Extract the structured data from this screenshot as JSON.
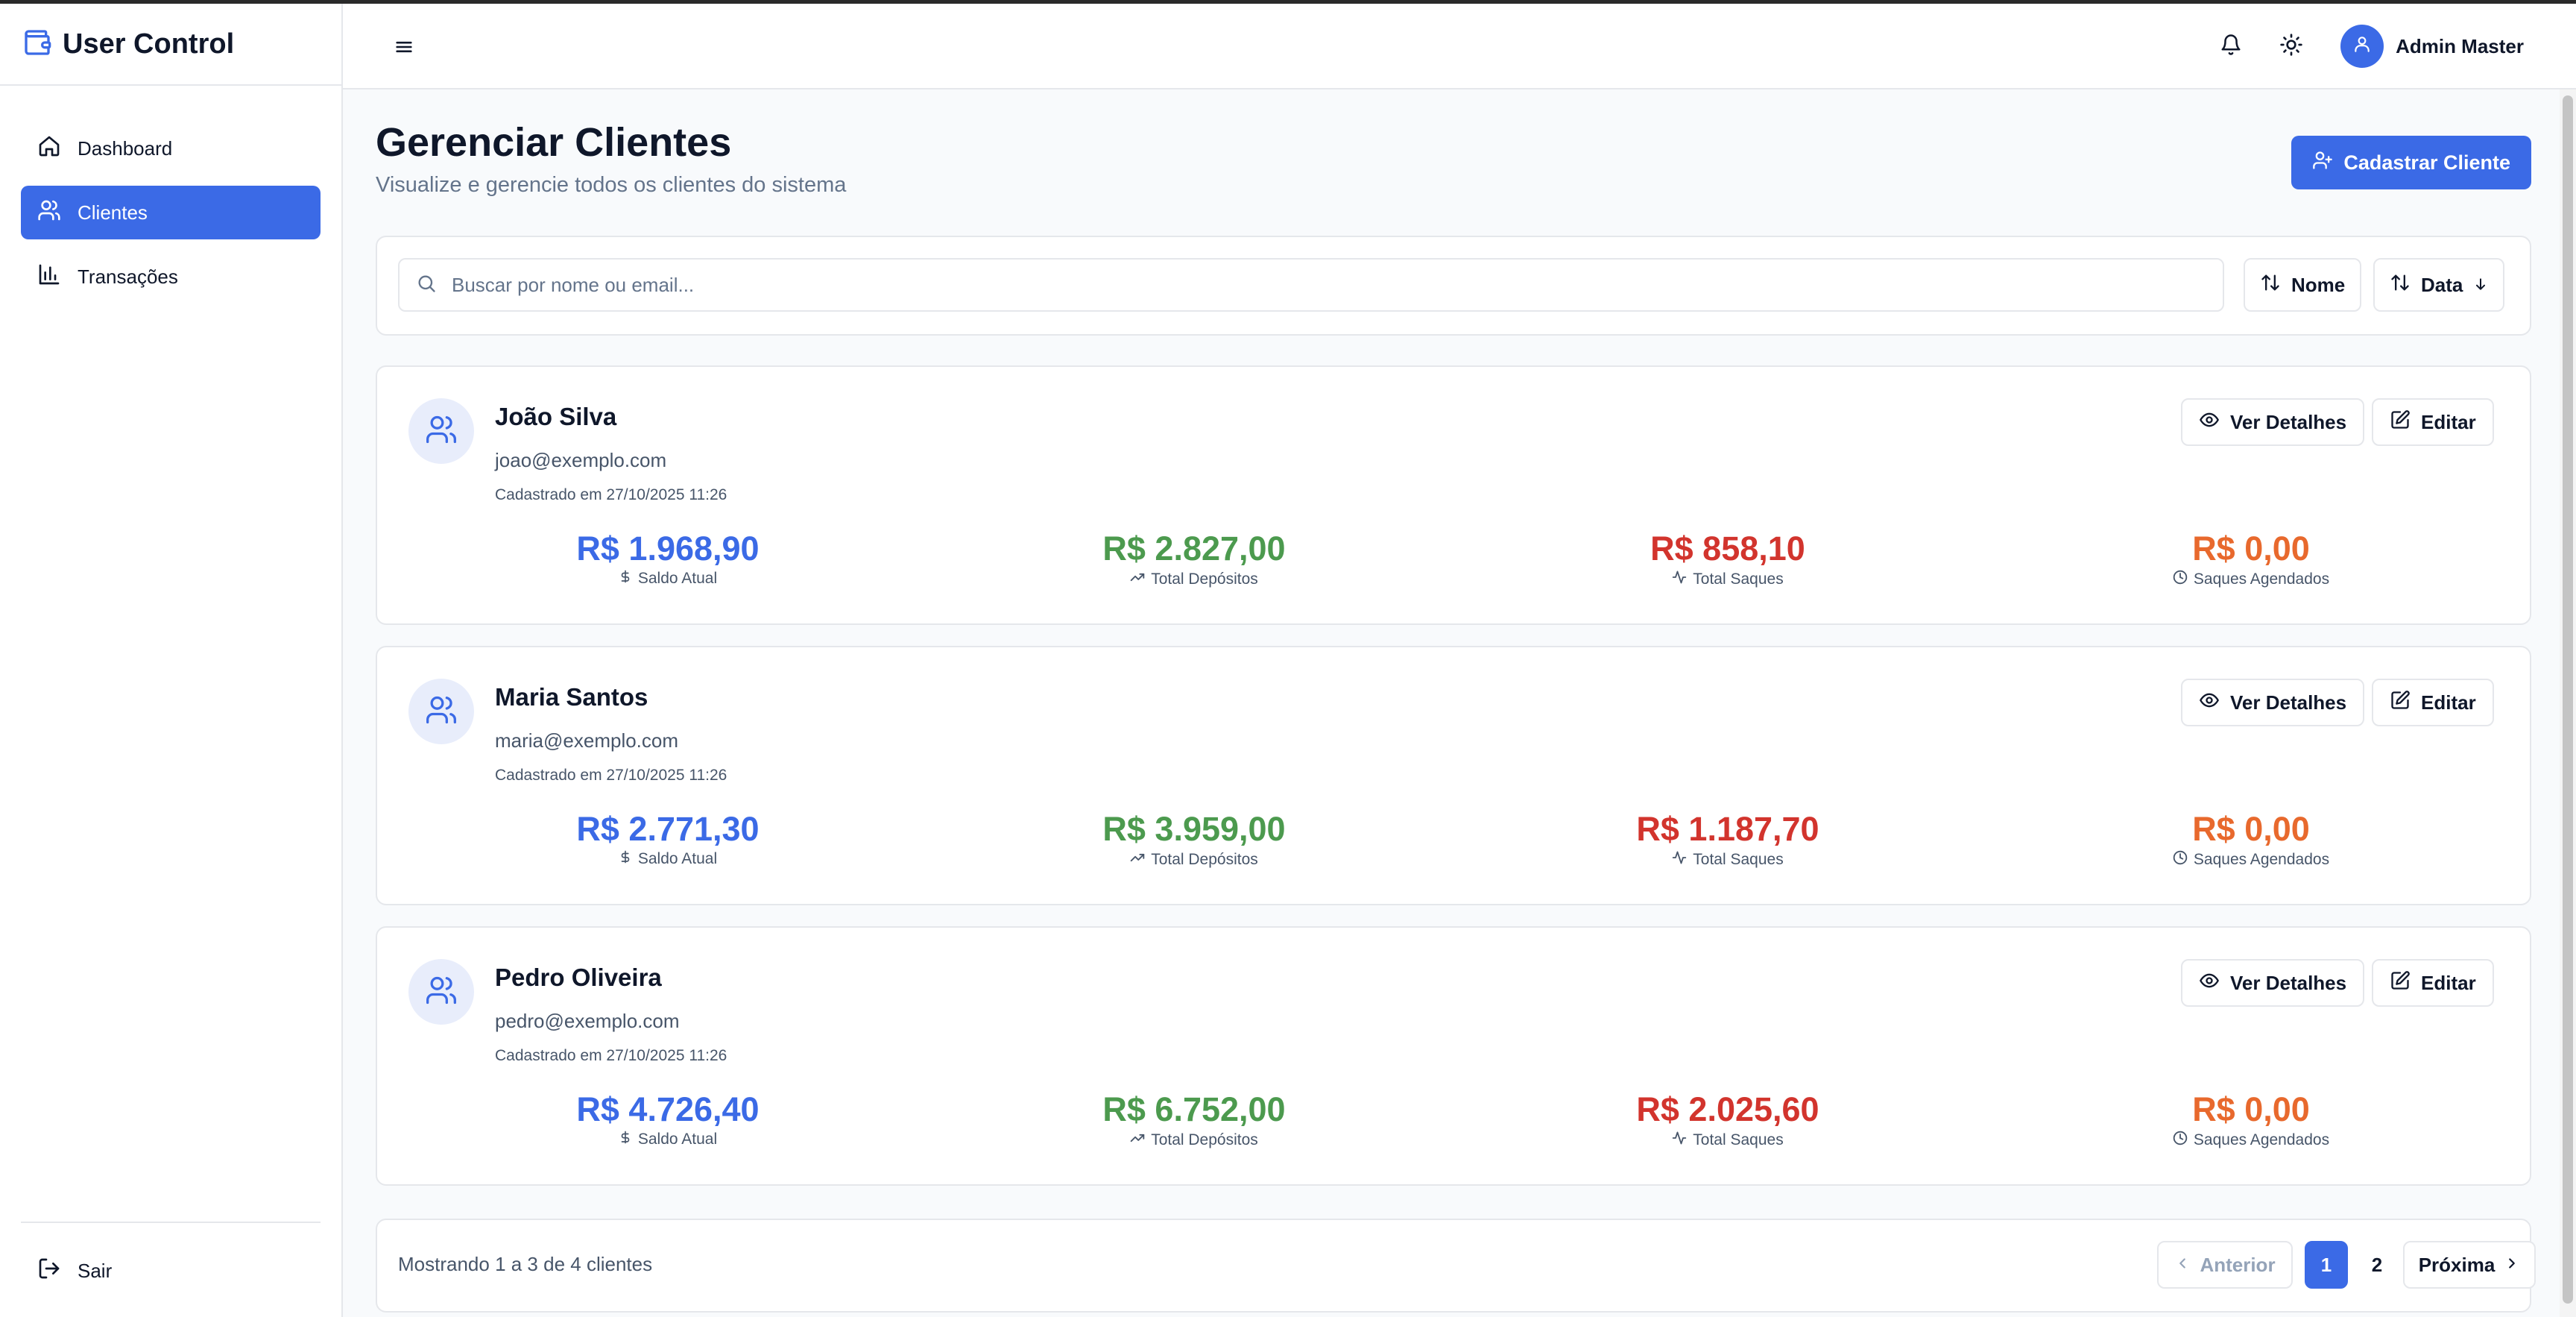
{
  "app": {
    "title": "User Control"
  },
  "sidebar": {
    "items": [
      {
        "label": "Dashboard",
        "icon": "home-icon",
        "active": false
      },
      {
        "label": "Clientes",
        "icon": "users-icon",
        "active": true
      },
      {
        "label": "Transações",
        "icon": "bar-chart-icon",
        "active": false
      }
    ],
    "logout_label": "Sair"
  },
  "header": {
    "user_name": "Admin Master"
  },
  "page": {
    "title": "Gerenciar Clientes",
    "subtitle": "Visualize e gerencie todos os clientes do sistema",
    "primary_button": "Cadastrar Cliente"
  },
  "search": {
    "placeholder": "Buscar por nome ou email...",
    "value": "",
    "sort_name_label": "Nome",
    "sort_date_label": "Data"
  },
  "labels": {
    "view_details": "Ver Detalhes",
    "edit": "Editar",
    "saldo": "Saldo Atual",
    "depositos": "Total Depósitos",
    "saques": "Total Saques",
    "agendados": "Saques Agendados"
  },
  "clients": [
    {
      "name": "João Silva",
      "email": "joao@exemplo.com",
      "registered": "Cadastrado em 27/10/2025 11:26",
      "saldo": "R$ 1.968,90",
      "depositos": "R$ 2.827,00",
      "saques": "R$ 858,10",
      "agendados": "R$ 0,00"
    },
    {
      "name": "Maria Santos",
      "email": "maria@exemplo.com",
      "registered": "Cadastrado em 27/10/2025 11:26",
      "saldo": "R$ 2.771,30",
      "depositos": "R$ 3.959,00",
      "saques": "R$ 1.187,70",
      "agendados": "R$ 0,00"
    },
    {
      "name": "Pedro Oliveira",
      "email": "pedro@exemplo.com",
      "registered": "Cadastrado em 27/10/2025 11:26",
      "saldo": "R$ 4.726,40",
      "depositos": "R$ 6.752,00",
      "saques": "R$ 2.025,60",
      "agendados": "R$ 0,00"
    }
  ],
  "pagination": {
    "summary": "Mostrando 1 a 3 de 4 clientes",
    "prev_label": "Anterior",
    "next_label": "Próxima",
    "pages": [
      "1",
      "2"
    ],
    "current": "1"
  },
  "colors": {
    "accent": "#3b6ae6",
    "saldo": "#3b6ae6",
    "depositos": "#4c9a4e",
    "saques": "#d2342d",
    "agendados": "#e8692d"
  }
}
